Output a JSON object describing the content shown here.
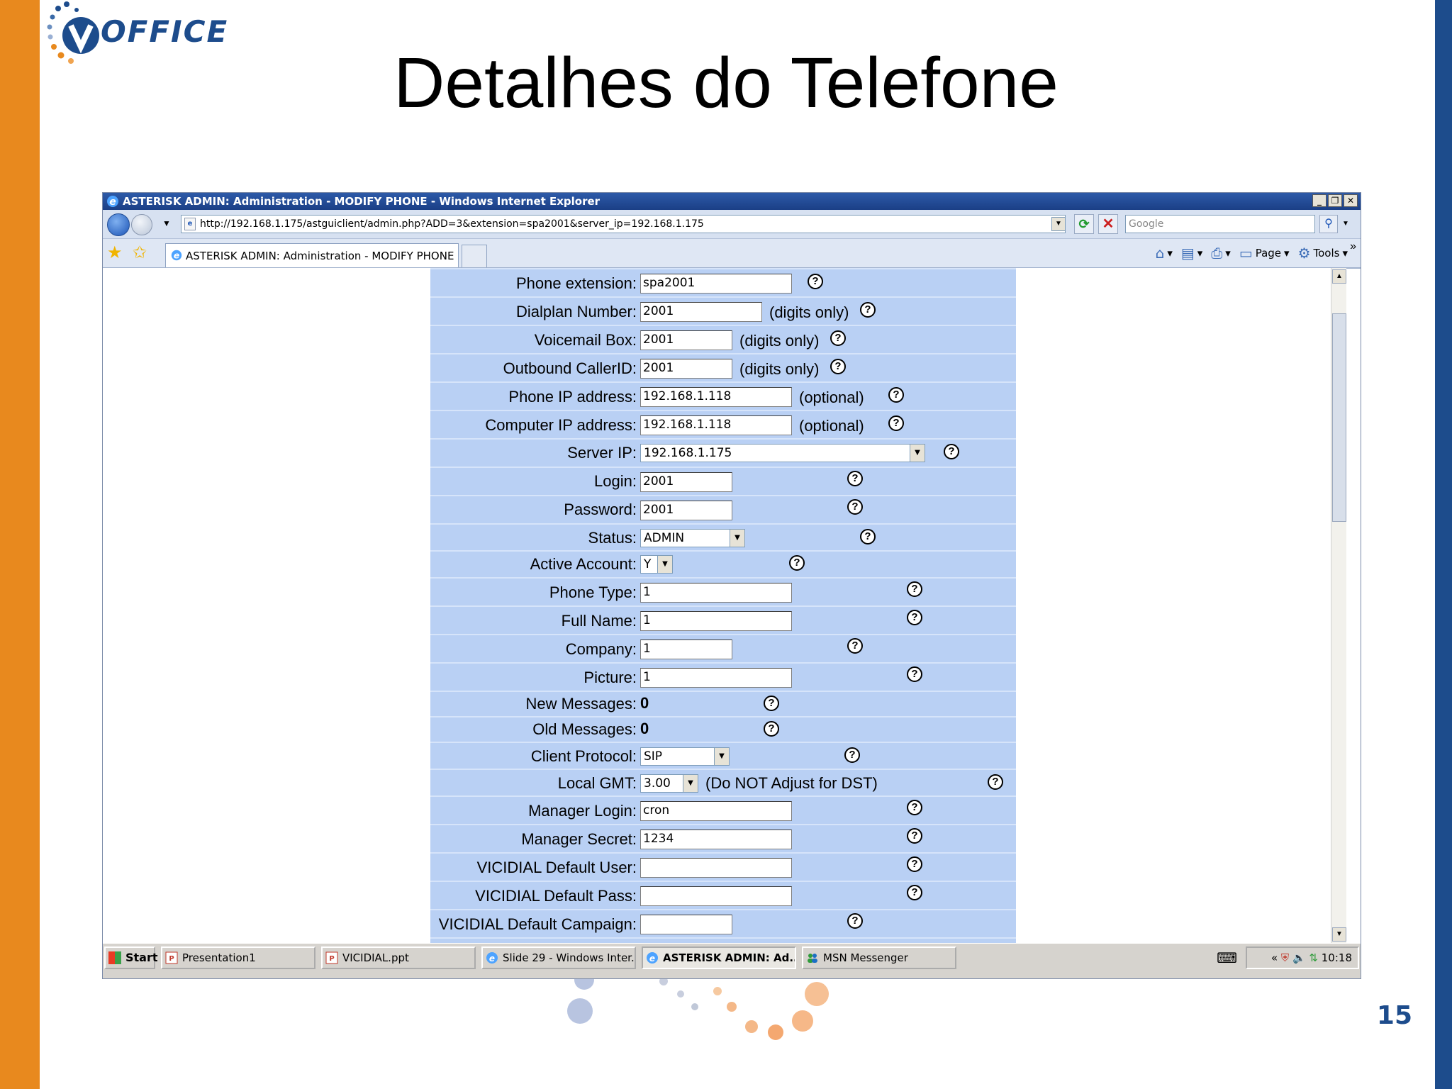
{
  "slide": {
    "logo_text": ".OFFICE",
    "title": "Detalhes do Telefone",
    "page_number": "15"
  },
  "browser": {
    "window_title": "ASTERISK ADMIN: Administration - MODIFY PHONE - Windows Internet Explorer",
    "url": "http://192.168.1.175/astguiclient/admin.php?ADD=3&extension=spa2001&server_ip=192.168.1.175",
    "search_placeholder": "Google",
    "tab_title": "ASTERISK ADMIN: Administration - MODIFY PHONE",
    "cmd_page": "Page",
    "cmd_tools": "Tools"
  },
  "form": {
    "phone_extension": {
      "label": "Phone extension:",
      "value": "spa2001"
    },
    "dialplan_number": {
      "label": "Dialplan Number:",
      "value": "2001",
      "note": "(digits only)"
    },
    "voicemail_box": {
      "label": "Voicemail Box:",
      "value": "2001",
      "note": "(digits only)"
    },
    "outbound_callerid": {
      "label": "Outbound CallerID:",
      "value": "2001",
      "note": "(digits only)"
    },
    "phone_ip": {
      "label": "Phone IP address:",
      "value": "192.168.1.118",
      "note": "(optional)"
    },
    "computer_ip": {
      "label": "Computer IP address:",
      "value": "192.168.1.118",
      "note": "(optional)"
    },
    "server_ip": {
      "label": "Server IP:",
      "value": "192.168.1.175"
    },
    "login": {
      "label": "Login:",
      "value": "2001"
    },
    "password": {
      "label": "Password:",
      "value": "2001"
    },
    "status": {
      "label": "Status:",
      "value": "ADMIN"
    },
    "active_account": {
      "label": "Active Account:",
      "value": "Y"
    },
    "phone_type": {
      "label": "Phone Type:",
      "value": "1"
    },
    "full_name": {
      "label": "Full Name:",
      "value": "1"
    },
    "company": {
      "label": "Company:",
      "value": "1"
    },
    "picture": {
      "label": "Picture:",
      "value": "1"
    },
    "new_messages": {
      "label": "New Messages:",
      "value": "0"
    },
    "old_messages": {
      "label": "Old Messages:",
      "value": "0"
    },
    "client_protocol": {
      "label": "Client Protocol:",
      "value": "SIP"
    },
    "local_gmt": {
      "label": "Local GMT:",
      "value": "3.00",
      "note": "(Do NOT Adjust for DST)"
    },
    "manager_login": {
      "label": "Manager Login:",
      "value": "cron"
    },
    "manager_secret": {
      "label": "Manager Secret:",
      "value": "1234"
    },
    "vicidial_default_user": {
      "label": "VICIDIAL Default User:",
      "value": ""
    },
    "vicidial_default_pass": {
      "label": "VICIDIAL Default Pass:",
      "value": ""
    },
    "vicidial_default_campaign": {
      "label": "VICIDIAL Default Campaign:",
      "value": ""
    },
    "help_glyph": "?"
  },
  "taskbar": {
    "start": "Start",
    "items": [
      "Presentation1",
      "VICIDIAL.ppt",
      "Slide 29 - Windows Inter...",
      "ASTERISK ADMIN: Ad...",
      "MSN Messenger"
    ],
    "tray_prefix": "«",
    "clock": "10:18"
  }
}
